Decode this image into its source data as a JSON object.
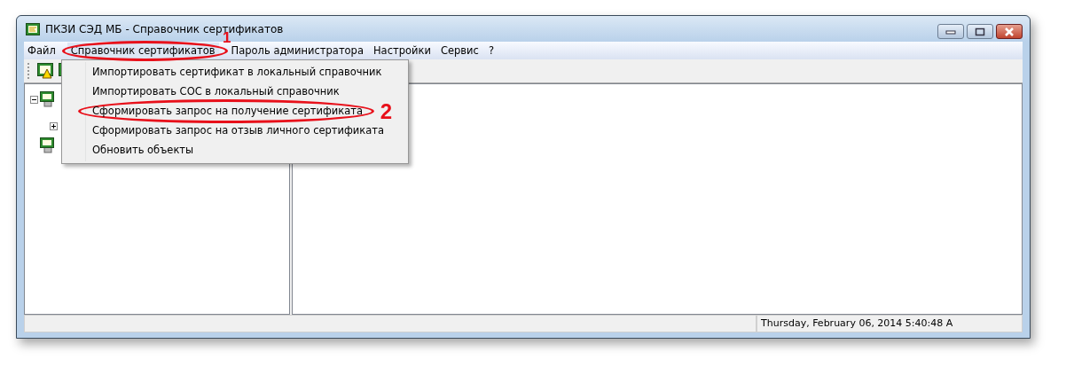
{
  "window": {
    "title": "ПКЗИ СЭД МБ - Справочник сертификатов"
  },
  "menu": [
    {
      "label": "Файл",
      "selected": false
    },
    {
      "label": "Справочник сертификатов",
      "selected": true,
      "callout": "1"
    },
    {
      "label": "Пароль администратора",
      "selected": false
    },
    {
      "label": "Настройки",
      "selected": false
    },
    {
      "label": "Сервис",
      "selected": false
    },
    {
      "label": "?",
      "selected": false
    }
  ],
  "dropdown": {
    "items": [
      {
        "label": "Импортировать сертификат в локальный справочник"
      },
      {
        "label": "Импортировать СОС в локальный справочник"
      },
      {
        "label": "Сформировать запрос на получение сертификата",
        "callout": "2"
      },
      {
        "label": "Сформировать запрос на отзыв личного сертификата"
      },
      {
        "label": "Обновить объекты"
      }
    ]
  },
  "tree": [
    {
      "kind": "group",
      "expanded": true,
      "children": [
        {
          "kind": "group",
          "expanded": false
        }
      ]
    },
    {
      "kind": "leaf"
    }
  ],
  "status_bar": {
    "text": "Thursday, February 06, 2014 5:40:48 A"
  }
}
